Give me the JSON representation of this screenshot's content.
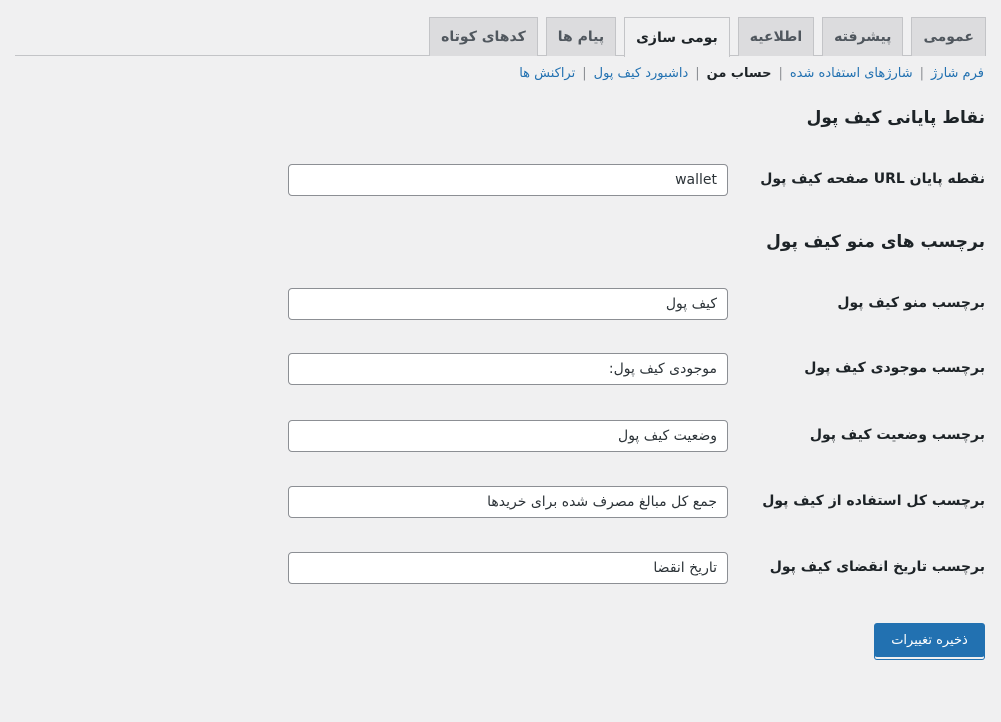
{
  "tabs": [
    {
      "label": "عمومی",
      "active": false
    },
    {
      "label": "پیشرفته",
      "active": false
    },
    {
      "label": "اطلاعیه",
      "active": false
    },
    {
      "label": "بومی سازی",
      "active": true
    },
    {
      "label": "پیام ها",
      "active": false
    },
    {
      "label": "کدهای کوتاه",
      "active": false
    }
  ],
  "subnav": {
    "items": [
      {
        "label": "فرم شارژ",
        "current": false
      },
      {
        "label": "شارژهای استفاده شده",
        "current": false
      },
      {
        "label": "حساب من",
        "current": true
      },
      {
        "label": "داشبورد کیف پول",
        "current": false
      },
      {
        "label": "تراکنش ها",
        "current": false
      }
    ],
    "separator": "|"
  },
  "sections": {
    "endpoints_title": "نقاط پایانی کیف پول",
    "menu_labels_title": "برچسب های منو کیف پول"
  },
  "fields": {
    "endpoint": {
      "label": "نقطه پایان URL صفحه کیف پول",
      "value": "wallet"
    },
    "menu_label": {
      "label": "برچسب منو کیف پول",
      "value": "کیف پول"
    },
    "balance_label": {
      "label": "برچسب موجودی کیف پول",
      "value": "موجودی کیف پول:"
    },
    "status_label": {
      "label": "برچسب وضعیت کیف پول",
      "value": "وضعیت کیف پول"
    },
    "total_used_label": {
      "label": "برچسب کل استفاده از کیف پول",
      "value": "جمع کل مبالغ مصرف شده برای خریدها"
    },
    "expiry_label": {
      "label": "برچسب تاریخ انقضای کیف پول",
      "value": "تاریخ انقضا"
    }
  },
  "save_button": {
    "label": "ذخیره تغییرات"
  },
  "colors": {
    "accent": "#2271b1",
    "background": "#f0f0f1"
  }
}
